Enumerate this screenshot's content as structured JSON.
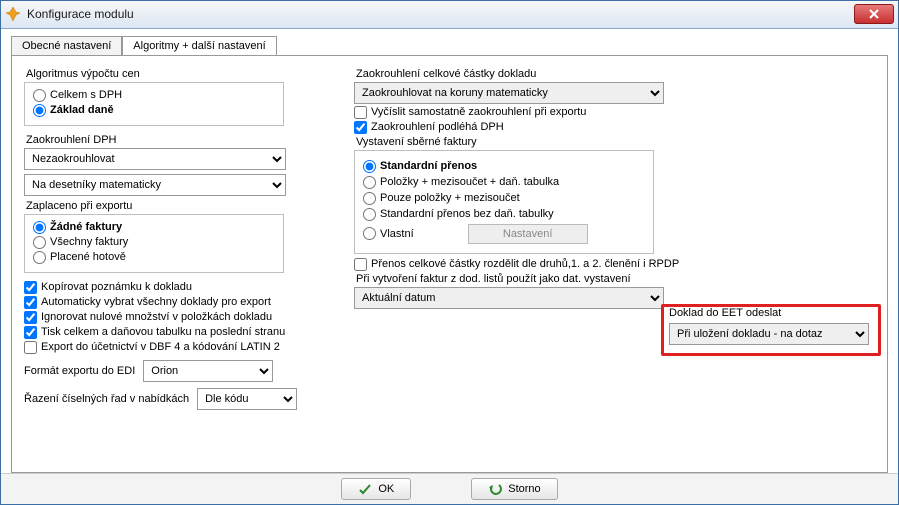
{
  "window": {
    "title": "Konfigurace modulu"
  },
  "tabs": {
    "general": "Obecné nastavení",
    "algo": "Algoritmy + další nastavení"
  },
  "left": {
    "alg_label": "Algoritmus výpočtu cen",
    "alg_opts": {
      "celkem": "Celkem s DPH",
      "zaklad": "Základ daně"
    },
    "zaokr_dph_label": "Zaokrouhlení DPH",
    "zaokr_dph_sel1": "Nezaokrouhlovat",
    "zaokr_dph_sel2": "Na desetníky matematicky",
    "zaplaceno_label": "Zaplaceno při exportu",
    "zaplaceno_opts": {
      "zadne": "Žádné faktury",
      "vsechny": "Všechny faktury",
      "hotove": "Placené hotově"
    },
    "chk": {
      "kopirovat": "Kopírovat poznámku k dokladu",
      "autovybrat": "Automaticky vybrat všechny doklady pro export",
      "ignorovat": "Ignorovat nulové množství v položkách dokladu",
      "tisk": "Tisk celkem a daňovou tabulku na poslední stranu",
      "export": "Export do účetnictví v DBF 4 a kódování LATIN 2"
    },
    "edi_label": "Formát exportu do EDI",
    "edi_sel": "Orion",
    "razeni_label": "Řazení číselných řad v nabídkách",
    "razeni_sel": "Dle kódu"
  },
  "right": {
    "zaokr_cast_label": "Zaokrouhlení celkové částky dokladu",
    "zaokr_cast_sel": "Zaokrouhlovat na koruny matematicky",
    "chk_vycislit": "Vyčíslit samostatně zaokrouhlení při exportu",
    "chk_podleha": "Zaokrouhlení podléhá DPH",
    "sberne_label": "Vystavení sběrné faktury",
    "sberne_opts": {
      "standard": "Standardní přenos",
      "polozky_tab": "Položky + mezisoučet + daň. tabulka",
      "polozky": "Pouze položky + mezisoučet",
      "standard_bez": "Standardní přenos bez daň. tabulky",
      "vlastni": "Vlastní"
    },
    "nastaveni_btn": "Nastavení",
    "chk_prenos": "Přenos celkové částky rozdělit dle druhů,1. a 2. členění i RPDP",
    "vytvoreni_label": "Při vytvoření faktur z dod. listů použít jako dat. vystavení",
    "vytvoreni_sel": "Aktuální datum",
    "eet_label": "Doklad do EET odeslat",
    "eet_sel": "Při uložení dokladu - na dotaz"
  },
  "footer": {
    "ok": "OK",
    "storno": "Storno"
  }
}
